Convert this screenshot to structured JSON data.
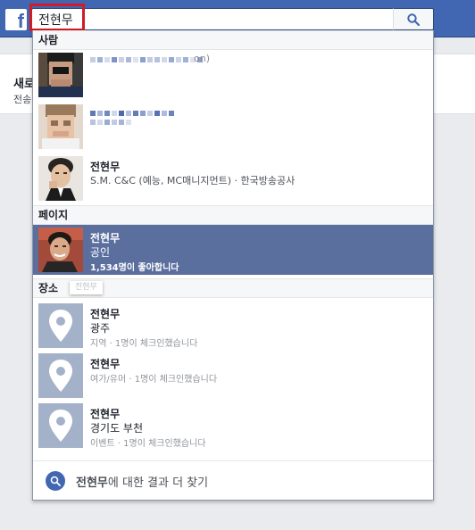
{
  "background_card": {
    "title": "새로",
    "subtitle": "전송"
  },
  "search": {
    "value": "전현무",
    "placeholder": ""
  },
  "sections": {
    "people": "사람",
    "pages": "페이지",
    "places": "장소"
  },
  "people": [
    {
      "name_fragment": "on)"
    },
    {
      "name_fragment": ""
    },
    {
      "name": "전현무",
      "detail": "S.M. C&C (예능, MC매니지먼트) · 한국방송공사"
    }
  ],
  "pages": [
    {
      "name": "전현무",
      "category": "공인",
      "likes": "1,534명이 좋아합니다"
    }
  ],
  "tooltip": "전현무",
  "places": [
    {
      "name": "전현무",
      "sub": "광주",
      "meta": "지역 · 1명이 체크인했습니다"
    },
    {
      "name": "전현무",
      "sub": "",
      "meta": "여가/유머 · 1명이 체크인했습니다"
    },
    {
      "name": "전현무",
      "sub": "경기도 부천",
      "meta": "이벤트 · 1명이 체크인했습니다"
    }
  ],
  "footer": {
    "query": "전현무",
    "suffix": "에 대한 결과 더 찾기"
  },
  "colors": {
    "brand": "#4267b2",
    "selected_row": "#5b6f9e",
    "highlight": "#d01c26"
  }
}
